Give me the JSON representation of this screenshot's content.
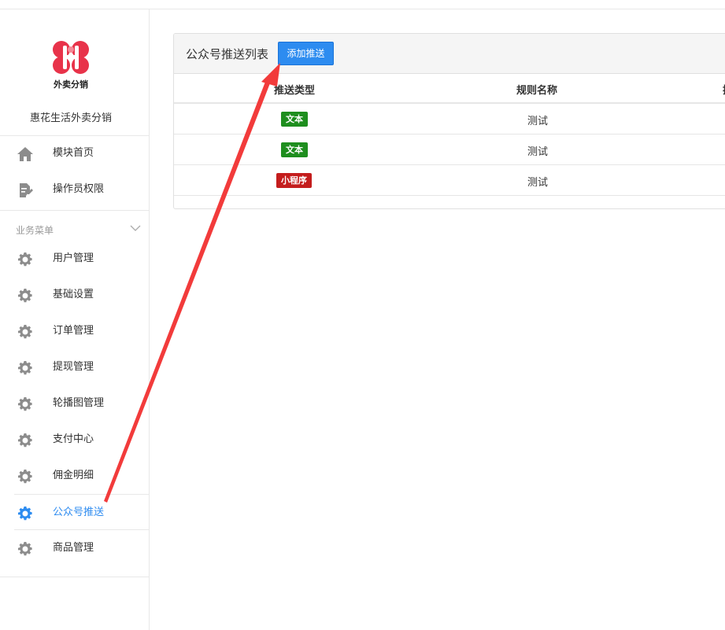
{
  "sidebar": {
    "logo_text": "外卖分销",
    "app_name": "惠花生活外卖分销",
    "top_items": [
      {
        "label": "模块首页",
        "icon": "home-icon"
      },
      {
        "label": "操作员权限",
        "icon": "document-edit-icon"
      }
    ],
    "group_title": "业务菜单",
    "items": [
      {
        "label": "用户管理",
        "icon": "gear-icon"
      },
      {
        "label": "基础设置",
        "icon": "gear-icon"
      },
      {
        "label": "订单管理",
        "icon": "gear-icon"
      },
      {
        "label": "提现管理",
        "icon": "gear-icon"
      },
      {
        "label": "轮播图管理",
        "icon": "gear-icon"
      },
      {
        "label": "支付中心",
        "icon": "gear-icon"
      },
      {
        "label": "佣金明细",
        "icon": "gear-icon"
      },
      {
        "label": "公众号推送",
        "icon": "gear-icon",
        "active": true
      },
      {
        "label": "商品管理",
        "icon": "gear-icon"
      }
    ]
  },
  "main": {
    "panel_title": "公众号推送列表",
    "add_button": "添加推送",
    "columns": [
      "推送类型",
      "规则名称",
      "操"
    ],
    "rows": [
      {
        "type": "文本",
        "type_color": "#1e8e1e",
        "name": "测试"
      },
      {
        "type": "文本",
        "type_color": "#1e8e1e",
        "name": "测试"
      },
      {
        "type": "小程序",
        "type_color": "#c41d1d",
        "name": "测试"
      }
    ]
  },
  "colors": {
    "accent": "#2d8cf0",
    "logo_red": "#e8334a",
    "arrow_red": "#f23b3b"
  }
}
